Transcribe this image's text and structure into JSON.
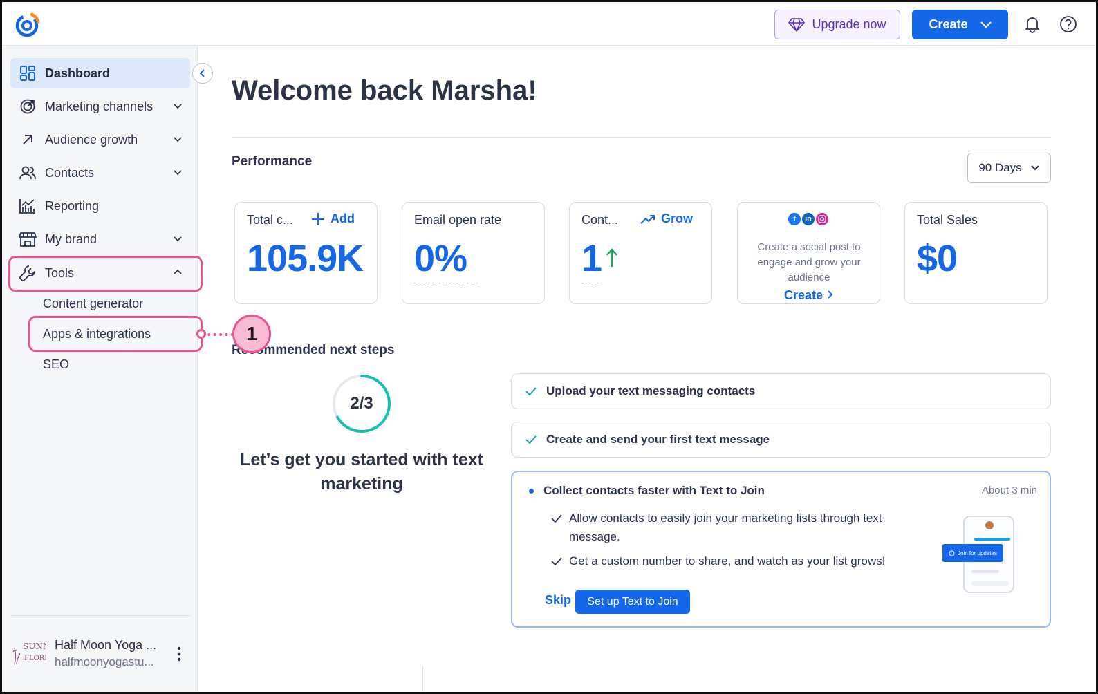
{
  "topbar": {
    "upgrade_label": "Upgrade now",
    "create_label": "Create"
  },
  "sidebar": {
    "items": [
      {
        "label": "Dashboard"
      },
      {
        "label": "Marketing channels"
      },
      {
        "label": "Audience growth"
      },
      {
        "label": "Contacts"
      },
      {
        "label": "Reporting"
      },
      {
        "label": "My brand"
      },
      {
        "label": "Tools"
      }
    ],
    "tools_sub": [
      {
        "label": "Content generator"
      },
      {
        "label": "Apps & integrations"
      },
      {
        "label": "SEO"
      }
    ],
    "account": {
      "logo_text": "SUNNY'S FLORIST",
      "name": "Half Moon Yoga ...",
      "email": "halfmoonyogastu..."
    }
  },
  "callout": {
    "number": "1"
  },
  "main": {
    "welcome": "Welcome back Marsha!",
    "performance_title": "Performance",
    "days_select": "90 Days",
    "cards": [
      {
        "label": "Total c...",
        "link": "Add",
        "value": "105.9K"
      },
      {
        "label": "Email open rate",
        "value": "0%"
      },
      {
        "label": "Cont...",
        "link": "Grow",
        "value": "1"
      },
      {
        "text": "Create a social post to engage and grow your audience",
        "link": "Create"
      },
      {
        "label": "Total Sales",
        "value": "$0"
      }
    ],
    "recommended_title": "Recommended next steps",
    "progress": {
      "text": "2/3",
      "fraction": 0.667
    },
    "rec_heading": "Let’s get you started with text marketing",
    "steps": [
      {
        "label": "Upload your text messaging contacts"
      },
      {
        "label": "Create and send your first text message"
      }
    ],
    "open_step": {
      "title": "Collect contacts faster with Text to Join",
      "time": "About 3 min",
      "bullets": [
        "Allow contacts to easily join your marketing lists through text message.",
        "Get a custom number to share, and watch as your list grows!"
      ],
      "skip_label": "Skip",
      "setup_label": "Set up Text to Join",
      "phone_button": "Join for updates"
    }
  },
  "colors": {
    "primary": "#1467e6",
    "highlight": "#e9548f",
    "progress": "#13c2b3"
  }
}
